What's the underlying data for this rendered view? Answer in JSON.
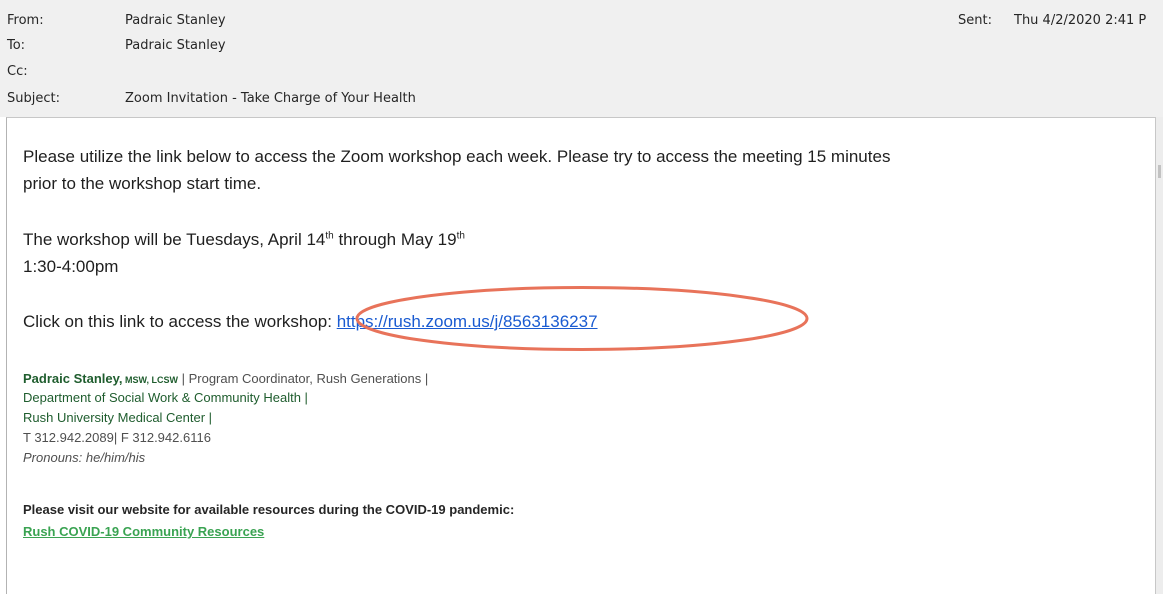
{
  "header": {
    "from_label": "From:",
    "from_value": "Padraic Stanley",
    "to_label": "To:",
    "to_value": "Padraic Stanley",
    "cc_label": "Cc:",
    "cc_value": "",
    "subject_label": "Subject:",
    "subject_value": "Zoom Invitation - Take Charge of Your Health",
    "sent_label": "Sent:",
    "sent_value": "Thu 4/2/2020 2:41 P"
  },
  "message": {
    "line1": "Please utilize the link below to access the Zoom workshop each week. Please try to access the meeting 15 minutes",
    "line2": "prior to the workshop start time.",
    "schedule_prefix": "The workshop will be Tuesdays, April 14",
    "schedule_sup1": "th",
    "schedule_middle": " through May 19",
    "schedule_sup2": "th",
    "time": "1:30-4:00pm",
    "link_prefix": "Click on this link to access the workshop: ",
    "link_url": "https://rush.zoom.us/j/8563136237"
  },
  "signature": {
    "name": "Padraic Stanley,",
    "credentials": " MSW, LCSW",
    "title_line": "  |  Program Coordinator, Rush Generations |",
    "department": "Department of Social Work & Community Health |",
    "org": "Rush University Medical Center |",
    "phone": "T 312.942.2089| F 312.942.6116",
    "pronouns": "Pronouns: he/him/his"
  },
  "covid": {
    "text": "Please visit our website for available resources during the COVID-19 pandemic:",
    "link": "Rush COVID-19 Community Resources"
  },
  "colors": {
    "header_bg": "#f0f0f0",
    "link_blue": "#1a5bd1",
    "signature_green": "#1f5d2e",
    "covid_link_green": "#3aa352",
    "highlight_orange": "#e8735a"
  }
}
